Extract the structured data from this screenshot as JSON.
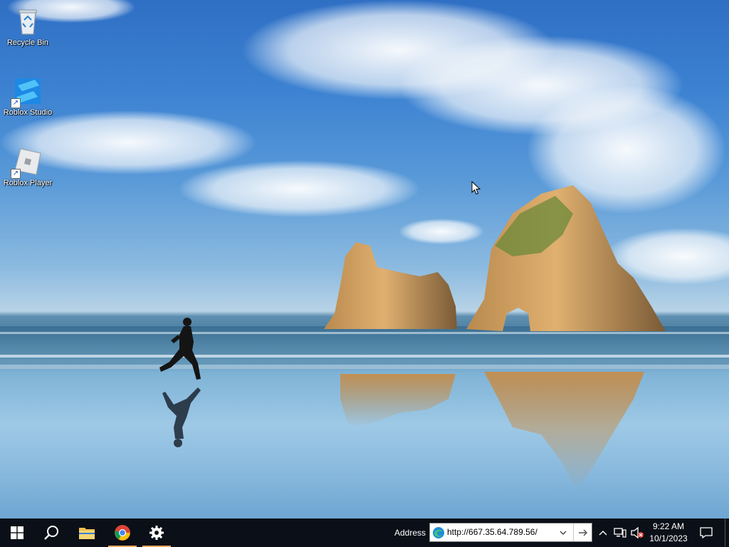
{
  "desktop": {
    "icons": [
      {
        "label": "Recycle Bin",
        "icon": "recycle-bin-icon"
      },
      {
        "label": "Roblox Studio",
        "icon": "roblox-studio-icon"
      },
      {
        "label": "Roblox Player",
        "icon": "roblox-player-icon"
      }
    ]
  },
  "taskbar": {
    "pinned": [
      {
        "name": "start",
        "icon": "windows-logo-icon"
      },
      {
        "name": "search",
        "icon": "search-icon"
      },
      {
        "name": "file-explorer",
        "icon": "folder-icon"
      },
      {
        "name": "chrome",
        "icon": "chrome-icon"
      },
      {
        "name": "settings",
        "icon": "gear-icon"
      }
    ],
    "address": {
      "label": "Address",
      "value": "http://667.35.64.789.56/"
    },
    "clock": {
      "time": "9:22 AM",
      "date": "10/1/2023"
    },
    "accent_color": "#f2a65a"
  }
}
